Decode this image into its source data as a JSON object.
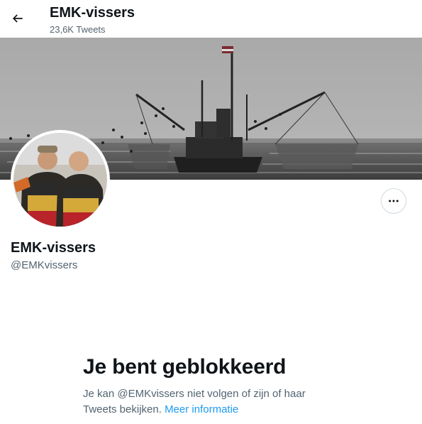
{
  "header": {
    "title": "EMK-vissers",
    "tweet_count": "23,6K Tweets"
  },
  "profile": {
    "name": "EMK-vissers",
    "handle": "@EMKvissers"
  },
  "blocked": {
    "title": "Je bent geblokkeerd",
    "message_line1": "Je kan @EMKvissers niet volgen of zijn of haar",
    "message_line2": "Tweets bekijken.",
    "link_text": "Meer informatie"
  },
  "icons": {
    "back": "arrow-left-icon",
    "more": "more-horizontal-icon"
  },
  "colors": {
    "text_primary": "#0f1419",
    "text_secondary": "#536471",
    "link": "#1d9bf0",
    "border": "#cfd9de"
  }
}
